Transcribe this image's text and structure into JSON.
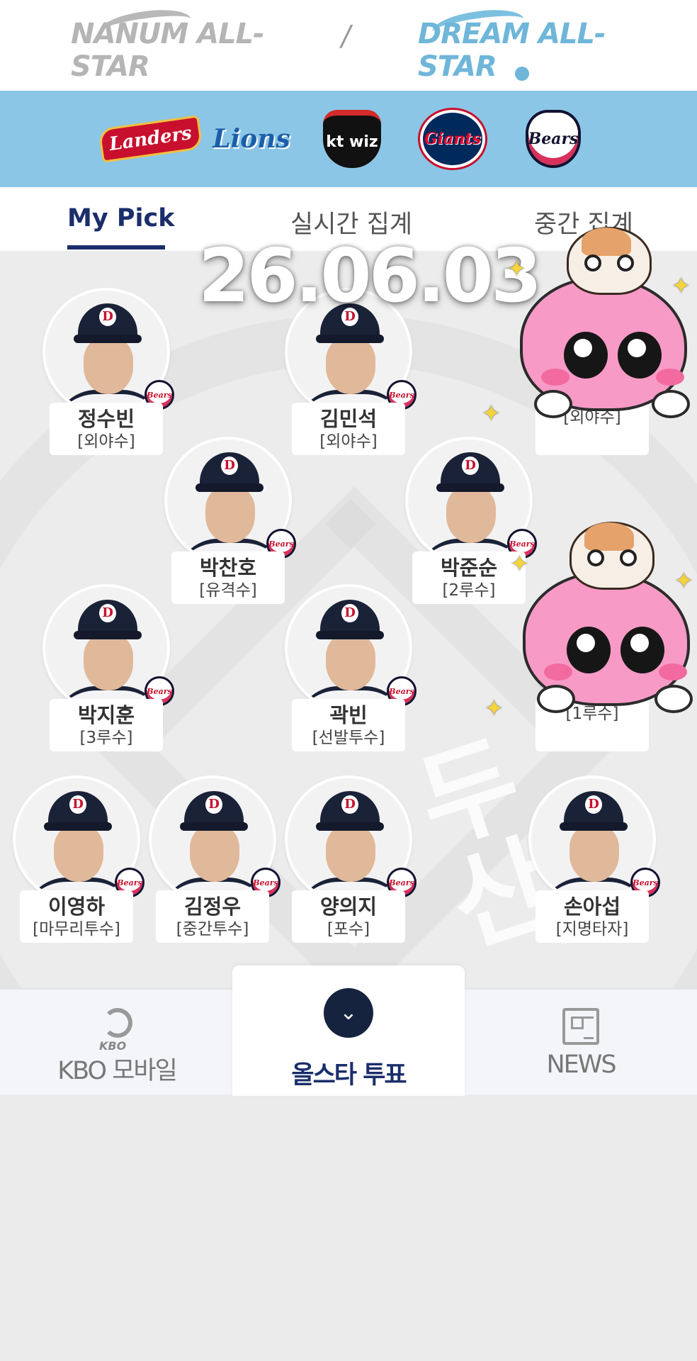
{
  "league": {
    "nanum_label": "NANUM ALL-STAR",
    "separator": "/",
    "dream_label": "DREAM ALL-STAR"
  },
  "teams": [
    {
      "name": "Landers",
      "icon": "landers-logo-icon"
    },
    {
      "name": "Lions",
      "icon": "lions-logo-icon"
    },
    {
      "name": "kt wiz",
      "icon": "ktwiz-logo-icon"
    },
    {
      "name": "Giants",
      "icon": "giants-logo-icon"
    },
    {
      "name": "Bears",
      "icon": "bears-logo-icon"
    }
  ],
  "tabs": [
    {
      "label": "My Pick",
      "active": true
    },
    {
      "label": "실시간 집계",
      "active": false
    },
    {
      "label": "중간 집계",
      "active": false
    }
  ],
  "date_overlay": "26.06.03",
  "team_badge": "Bears",
  "players": [
    {
      "name": "정수빈",
      "position": "[외야수]"
    },
    {
      "name": "김민석",
      "position": "[외야수]"
    },
    {
      "name": "",
      "position": "[외야수]"
    },
    {
      "name": "박찬호",
      "position": "[유격수]"
    },
    {
      "name": "박준순",
      "position": "[2루수]"
    },
    {
      "name": "박지훈",
      "position": "[3루수]"
    },
    {
      "name": "곽빈",
      "position": "[선발투수]"
    },
    {
      "name": "",
      "position": "[1루수]"
    },
    {
      "name": "이영하",
      "position": "[마무리투수]"
    },
    {
      "name": "김정우",
      "position": "[중간투수]"
    },
    {
      "name": "양의지",
      "position": "[포수]"
    },
    {
      "name": "손아섭",
      "position": "[지명타자]"
    }
  ],
  "bottom_nav": {
    "kbo_sub": "KBO",
    "kbo_label": "KBO 모바일",
    "vote_icon": "chevron-down-icon",
    "vote_label": "올스타 투표",
    "news_label": "NEWS"
  },
  "colors": {
    "accent": "#1b2e6b",
    "team_bar": "#8bc6e6",
    "dream": "#6fb6d9",
    "nanum": "#b5b5b5"
  }
}
